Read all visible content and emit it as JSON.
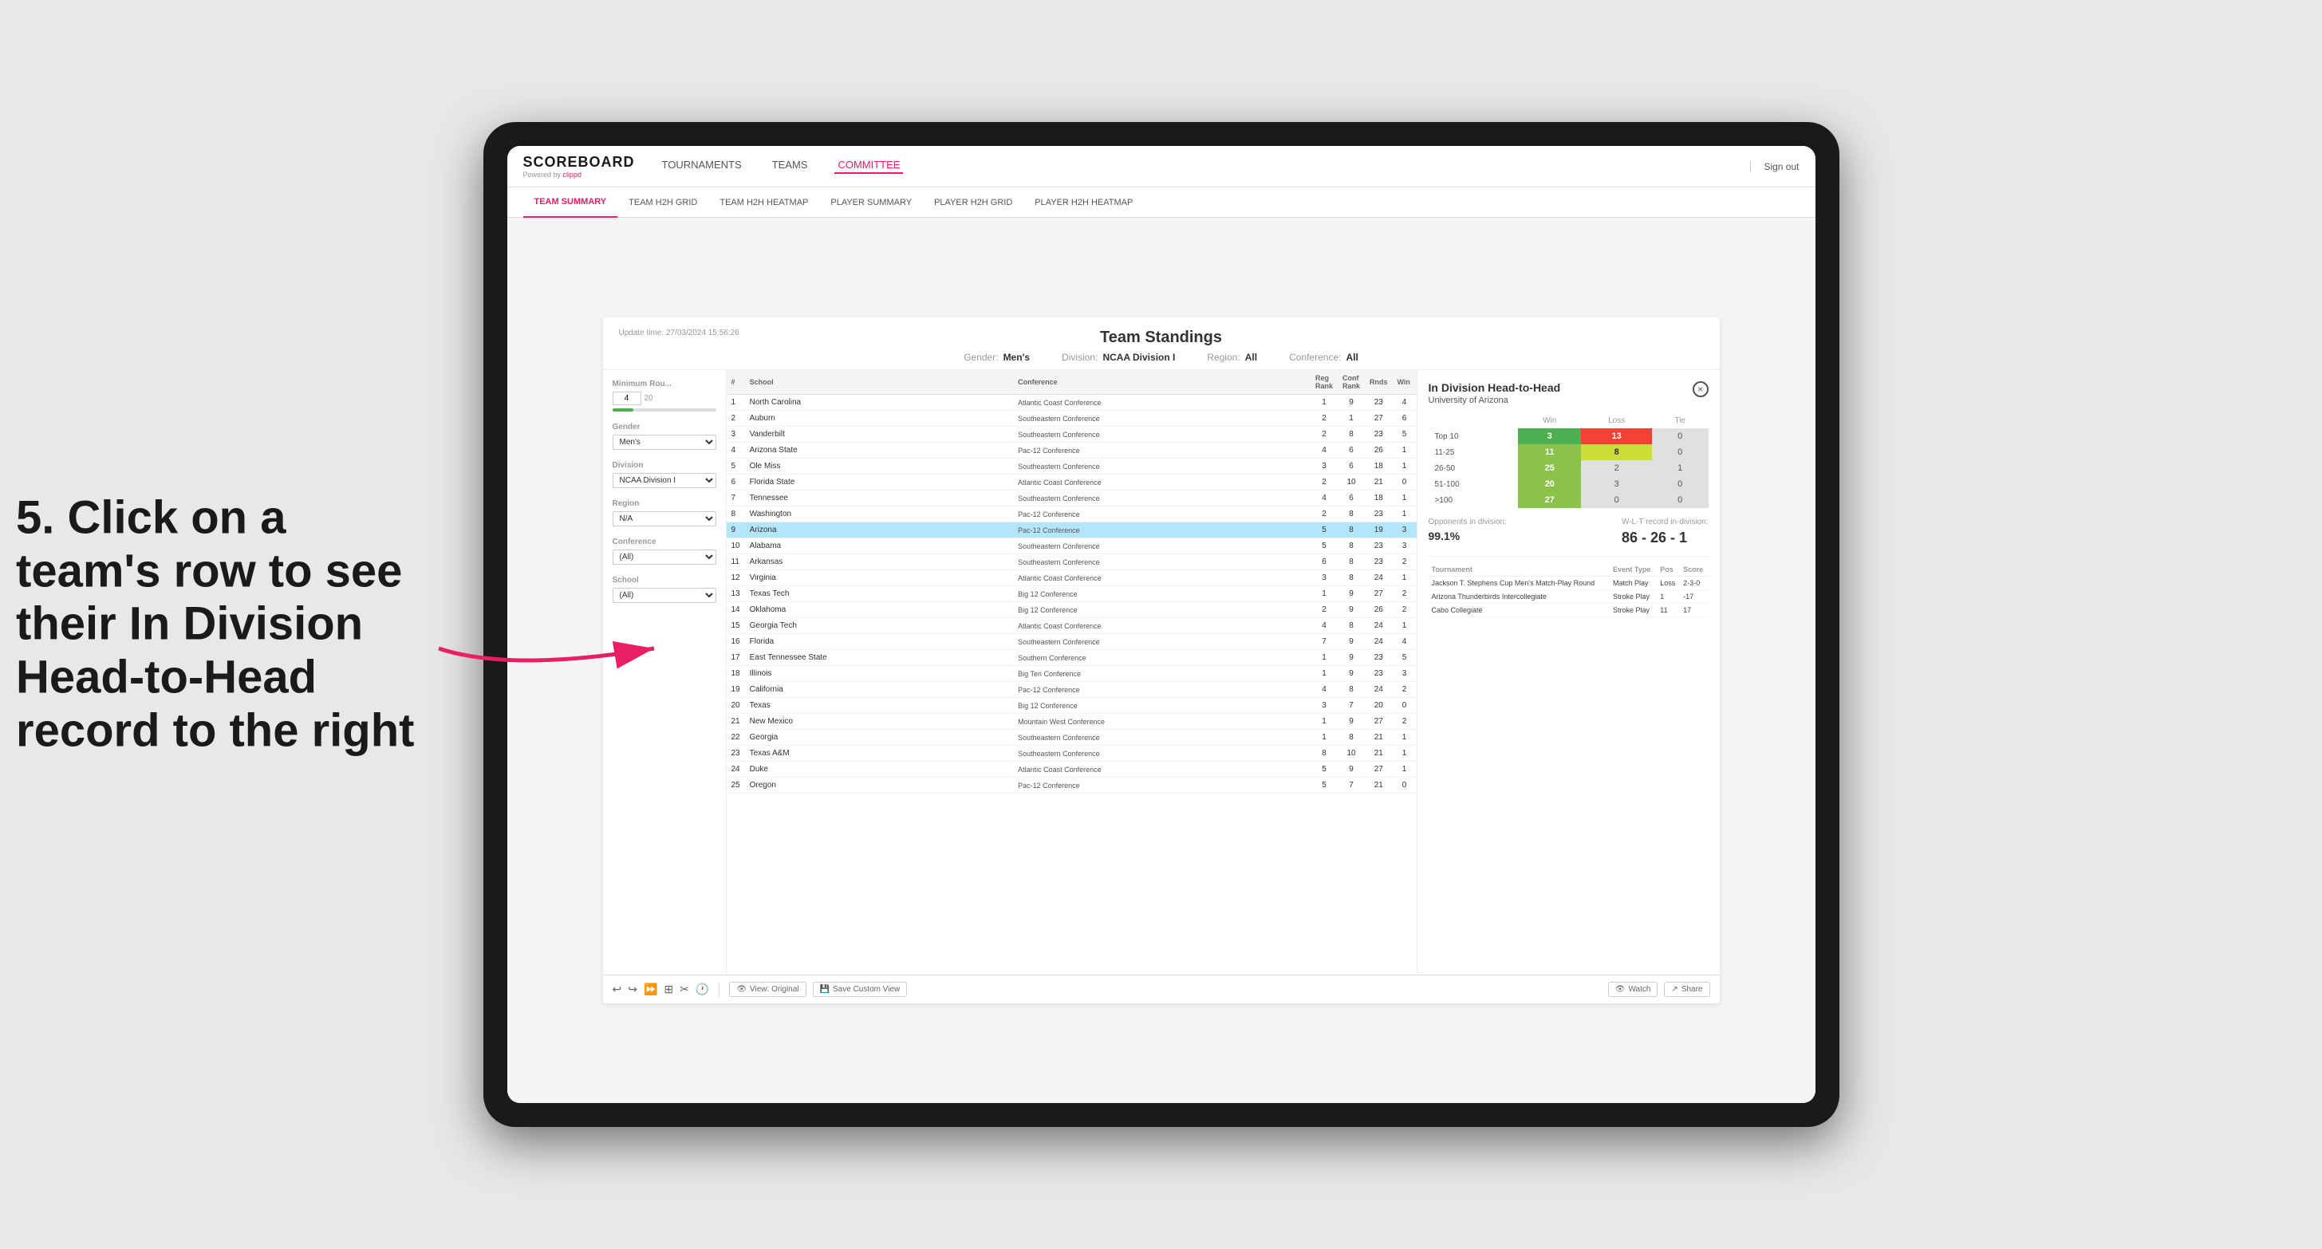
{
  "annotation": {
    "line1": "5. Click on a",
    "line2": "team's row to see",
    "line3": "their In Division",
    "line4": "Head-to-Head",
    "line5": "record to the right"
  },
  "topNav": {
    "logo": "SCOREBOARD",
    "logoSub": "Powered by",
    "logoSubBrand": "clippd",
    "links": [
      "TOURNAMENTS",
      "TEAMS",
      "COMMITTEE"
    ],
    "signOut": "Sign out"
  },
  "subNav": {
    "links": [
      "TEAM SUMMARY",
      "TEAM H2H GRID",
      "TEAM H2H HEATMAP",
      "PLAYER SUMMARY",
      "PLAYER H2H GRID",
      "PLAYER H2H HEATMAP"
    ]
  },
  "dashboard": {
    "title": "Team Standings",
    "updateTime": "Update time: 27/03/2024 15:56:26",
    "filters": {
      "gender": "Men's",
      "division": "NCAA Division I",
      "region": "All",
      "conference": "All"
    }
  },
  "sidebarFilters": {
    "minRouLabel": "Minimum Rou...",
    "minRouValue": "4",
    "genderLabel": "Gender",
    "genderValue": "Men's",
    "divisionLabel": "Division",
    "divisionValue": "NCAA Division I",
    "regionLabel": "Region",
    "regionValue": "N/A",
    "conferenceLabel": "Conference",
    "conferenceValue": "(All)",
    "schoolLabel": "School",
    "schoolValue": "(All)"
  },
  "teams": [
    {
      "rank": 1,
      "name": "North Carolina",
      "conference": "Atlantic Coast Conference",
      "regRank": 1,
      "confRank": 9,
      "rnds": 23,
      "wins": 4
    },
    {
      "rank": 2,
      "name": "Auburn",
      "conference": "Southeastern Conference",
      "regRank": 2,
      "confRank": 1,
      "rnds": 27,
      "wins": 6
    },
    {
      "rank": 3,
      "name": "Vanderbilt",
      "conference": "Southeastern Conference",
      "regRank": 2,
      "confRank": 8,
      "rnds": 23,
      "wins": 5
    },
    {
      "rank": 4,
      "name": "Arizona State",
      "conference": "Pac-12 Conference",
      "regRank": 4,
      "confRank": 6,
      "rnds": 26,
      "wins": 1
    },
    {
      "rank": 5,
      "name": "Ole Miss",
      "conference": "Southeastern Conference",
      "regRank": 3,
      "confRank": 6,
      "rnds": 18,
      "wins": 1
    },
    {
      "rank": 6,
      "name": "Florida State",
      "conference": "Atlantic Coast Conference",
      "regRank": 2,
      "confRank": 10,
      "rnds": 21,
      "wins": 0
    },
    {
      "rank": 7,
      "name": "Tennessee",
      "conference": "Southeastern Conference",
      "regRank": 4,
      "confRank": 6,
      "rnds": 18,
      "wins": 1
    },
    {
      "rank": 8,
      "name": "Washington",
      "conference": "Pac-12 Conference",
      "regRank": 2,
      "confRank": 8,
      "rnds": 23,
      "wins": 1
    },
    {
      "rank": 9,
      "name": "Arizona",
      "conference": "Pac-12 Conference",
      "regRank": 5,
      "confRank": 8,
      "rnds": 19,
      "wins": 3,
      "selected": true
    },
    {
      "rank": 10,
      "name": "Alabama",
      "conference": "Southeastern Conference",
      "regRank": 5,
      "confRank": 8,
      "rnds": 23,
      "wins": 3
    },
    {
      "rank": 11,
      "name": "Arkansas",
      "conference": "Southeastern Conference",
      "regRank": 6,
      "confRank": 8,
      "rnds": 23,
      "wins": 2
    },
    {
      "rank": 12,
      "name": "Virginia",
      "conference": "Atlantic Coast Conference",
      "regRank": 3,
      "confRank": 8,
      "rnds": 24,
      "wins": 1
    },
    {
      "rank": 13,
      "name": "Texas Tech",
      "conference": "Big 12 Conference",
      "regRank": 1,
      "confRank": 9,
      "rnds": 27,
      "wins": 2
    },
    {
      "rank": 14,
      "name": "Oklahoma",
      "conference": "Big 12 Conference",
      "regRank": 2,
      "confRank": 9,
      "rnds": 26,
      "wins": 2
    },
    {
      "rank": 15,
      "name": "Georgia Tech",
      "conference": "Atlantic Coast Conference",
      "regRank": 4,
      "confRank": 8,
      "rnds": 24,
      "wins": 1
    },
    {
      "rank": 16,
      "name": "Florida",
      "conference": "Southeastern Conference",
      "regRank": 7,
      "confRank": 9,
      "rnds": 24,
      "wins": 4
    },
    {
      "rank": 17,
      "name": "East Tennessee State",
      "conference": "Southern Conference",
      "regRank": 1,
      "confRank": 9,
      "rnds": 23,
      "wins": 5
    },
    {
      "rank": 18,
      "name": "Illinois",
      "conference": "Big Ten Conference",
      "regRank": 1,
      "confRank": 9,
      "rnds": 23,
      "wins": 3
    },
    {
      "rank": 19,
      "name": "California",
      "conference": "Pac-12 Conference",
      "regRank": 4,
      "confRank": 8,
      "rnds": 24,
      "wins": 2
    },
    {
      "rank": 20,
      "name": "Texas",
      "conference": "Big 12 Conference",
      "regRank": 3,
      "confRank": 7,
      "rnds": 20,
      "wins": 0
    },
    {
      "rank": 21,
      "name": "New Mexico",
      "conference": "Mountain West Conference",
      "regRank": 1,
      "confRank": 9,
      "rnds": 27,
      "wins": 2
    },
    {
      "rank": 22,
      "name": "Georgia",
      "conference": "Southeastern Conference",
      "regRank": 1,
      "confRank": 8,
      "rnds": 21,
      "wins": 1
    },
    {
      "rank": 23,
      "name": "Texas A&M",
      "conference": "Southeastern Conference",
      "regRank": 8,
      "confRank": 10,
      "rnds": 21,
      "wins": 1
    },
    {
      "rank": 24,
      "name": "Duke",
      "conference": "Atlantic Coast Conference",
      "regRank": 5,
      "confRank": 9,
      "rnds": 27,
      "wins": 1
    },
    {
      "rank": 25,
      "name": "Oregon",
      "conference": "Pac-12 Conference",
      "regRank": 5,
      "confRank": 7,
      "rnds": 21,
      "wins": 0
    }
  ],
  "h2h": {
    "title": "In Division Head-to-Head",
    "subtitle": "University of Arizona",
    "closeLabel": "×",
    "headers": [
      "Win",
      "Loss",
      "Tie"
    ],
    "rows": [
      {
        "label": "Top 10",
        "win": 3,
        "loss": 13,
        "tie": 0,
        "winClass": "cell-green",
        "lossClass": "cell-red",
        "tieClass": "cell-gray"
      },
      {
        "label": "11-25",
        "win": 11,
        "loss": 8,
        "tie": 0,
        "winClass": "cell-light-green",
        "lossClass": "cell-yellow",
        "tieClass": "cell-gray"
      },
      {
        "label": "26-50",
        "win": 25,
        "loss": 2,
        "tie": 1,
        "winClass": "cell-light-green",
        "lossClass": "cell-gray",
        "tieClass": "cell-gray"
      },
      {
        "label": "51-100",
        "win": 20,
        "loss": 3,
        "tie": 0,
        "winClass": "cell-light-green",
        "lossClass": "cell-gray",
        "tieClass": "cell-gray"
      },
      {
        "label": ">100",
        "win": 27,
        "loss": 0,
        "tie": 0,
        "winClass": "cell-light-green",
        "lossClass": "cell-gray",
        "tieClass": "cell-gray"
      }
    ],
    "opponentsLabel": "Opponents in division:",
    "opponentsValue": "99.1%",
    "wltLabel": "W-L-T record in-division:",
    "wltValue": "86 - 26 - 1",
    "tournaments": [
      {
        "name": "Jackson T. Stephens Cup Men's Match-Play Round",
        "eventType": "Match Play",
        "pos": "Loss",
        "score": "2-3-0"
      },
      {
        "name": "Arizona Thunderbirds Intercollegiate",
        "eventType": "Stroke Play",
        "pos": "1",
        "score": "-17"
      },
      {
        "name": "Cabo Collegiate",
        "eventType": "Stroke Play",
        "pos": "11",
        "score": "17"
      }
    ]
  },
  "toolbar": {
    "buttons": [
      "View: Original",
      "Save Custom View"
    ],
    "rightButtons": [
      "Watch",
      "Share"
    ]
  }
}
